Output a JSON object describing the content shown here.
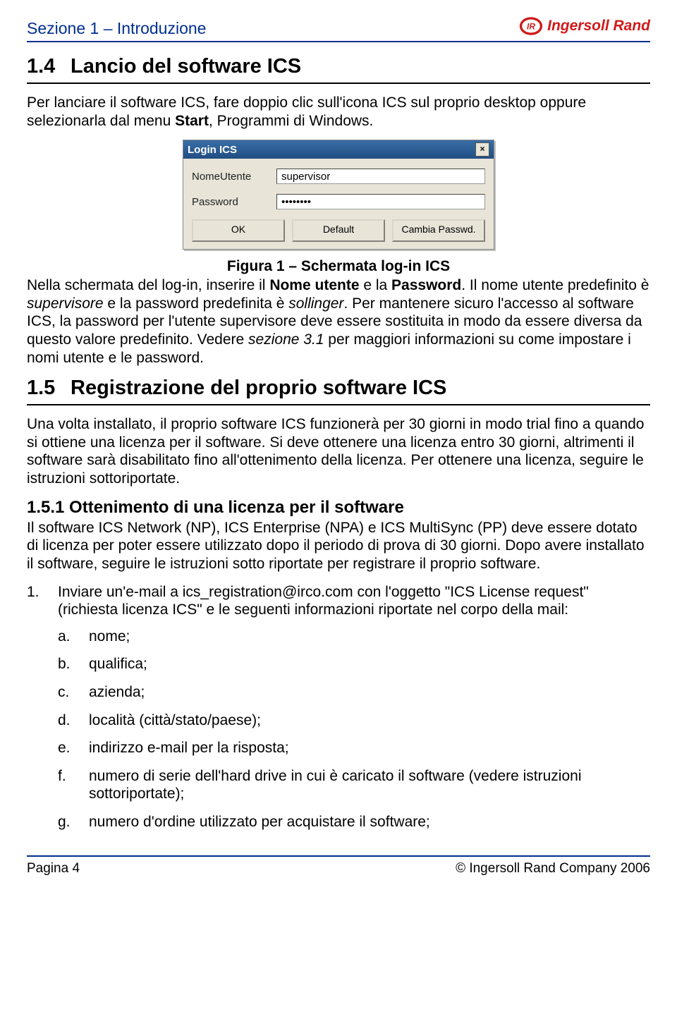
{
  "header": {
    "breadcrumb": "Sezione 1 – Introduzione",
    "logo_text": "Ingersoll Rand"
  },
  "section_1_4": {
    "number": "1.4",
    "title": "Lancio del software ICS",
    "para1_a": "Per lanciare il software ICS, fare doppio clic sull'icona ICS sul proprio desktop oppure selezionarla dal menu ",
    "para1_bold": "Start",
    "para1_b": ", Programmi di Windows."
  },
  "login_dialog": {
    "title": "Login ICS",
    "field_user_label": "NomeUtente",
    "field_user_value": "supervisor",
    "field_pass_label": "Password",
    "field_pass_value": "••••••••",
    "btn_ok": "OK",
    "btn_default": "Default",
    "btn_change": "Cambia Passwd.",
    "close_glyph": "×"
  },
  "figure_caption": "Figura 1 – Schermata log-in ICS",
  "para2": {
    "a": "Nella schermata del log-in, inserire il ",
    "b_bold": "Nome utente",
    "c": "e la ",
    "d_bold": "Password",
    "e": ". Il nome utente predefinito è ",
    "f_em": "supervisore",
    "g": " e la password predefinita è ",
    "h_em": "sollinger",
    "i": ". Per mantenere sicuro l'accesso al software ICS, la password per l'utente supervisore deve essere sostituita in modo da essere diversa da questo valore predefinito. Vedere ",
    "j_em": "sezione 3.1",
    "k": " per maggiori informazioni su come impostare i nomi utente e le password."
  },
  "section_1_5": {
    "number": "1.5",
    "title": "Registrazione del proprio software ICS",
    "para": "Una volta installato, il proprio software ICS funzionerà per 30 giorni in modo trial fino a quando si ottiene una licenza per il software. Si deve ottenere una licenza entro 30 giorni, altrimenti il software sarà disabilitato fino all'ottenimento della licenza. Per ottenere una licenza, seguire le istruzioni sottoriportate."
  },
  "section_1_5_1": {
    "title": "1.5.1 Ottenimento di una licenza per il software",
    "para": "Il software ICS Network (NP), ICS Enterprise (NPA) e ICS MultiSync (PP) deve essere dotato di licenza per poter essere utilizzato dopo il periodo di prova di 30 giorni. Dopo avere installato il software, seguire le istruzioni sotto riportate per registrare il proprio software.",
    "step1_marker": "1.",
    "step1_text": "Inviare un'e-mail a ics_registration@irco.com con l'oggetto \"ICS License request\" (richiesta licenza ICS\" e le seguenti informazioni riportate nel corpo della mail:",
    "items": [
      {
        "marker": "a.",
        "text": "nome;"
      },
      {
        "marker": "b.",
        "text": "qualifica;"
      },
      {
        "marker": "c.",
        "text": "azienda;"
      },
      {
        "marker": "d.",
        "text": "località (città/stato/paese);"
      },
      {
        "marker": "e.",
        "text": "indirizzo e-mail per la risposta;"
      },
      {
        "marker": "f.",
        "text": "numero di serie dell'hard drive in cui è caricato il software (vedere istruzioni sottoriportate);"
      },
      {
        "marker": "g.",
        "text": "numero d'ordine utilizzato per acquistare il software;"
      }
    ]
  },
  "footer": {
    "left": "Pagina 4",
    "right": "© Ingersoll Rand Company 2006"
  }
}
